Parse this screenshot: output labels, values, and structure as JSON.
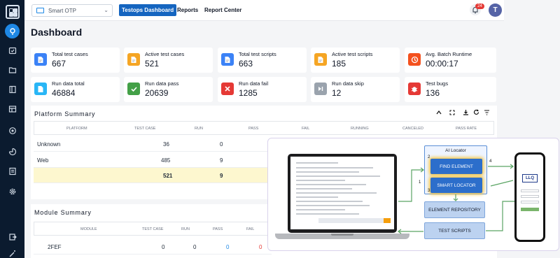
{
  "topbar": {
    "project": "Smart OTP",
    "nav": [
      "Testops Dashboard",
      "Reports",
      "Report Center"
    ],
    "notification_count": "24",
    "avatar_initial": "T"
  },
  "page_title": "Dashboard",
  "stats": [
    {
      "label": "Total test cases",
      "value": "667",
      "color": "#3b82f6",
      "icon": "document-icon"
    },
    {
      "label": "Active test cases",
      "value": "521",
      "color": "#f5a524",
      "icon": "document-icon"
    },
    {
      "label": "Total test scripts",
      "value": "663",
      "color": "#3b82f6",
      "icon": "document-icon"
    },
    {
      "label": "Active test scripts",
      "value": "185",
      "color": "#f5a524",
      "icon": "document-icon"
    },
    {
      "label": "Avg. Batch Runtime",
      "value": "00:00:17",
      "color": "#f4511e",
      "icon": "clock-icon"
    },
    {
      "label": "Run data total",
      "value": "46884",
      "color": "#29b6f6",
      "icon": "folder-icon"
    },
    {
      "label": "Run data pass",
      "value": "20639",
      "color": "#43a047",
      "icon": "check-icon"
    },
    {
      "label": "Run data fail",
      "value": "1285",
      "color": "#e53935",
      "icon": "close-icon"
    },
    {
      "label": "Run data skip",
      "value": "12",
      "color": "#9aa3ad",
      "icon": "skip-icon"
    },
    {
      "label": "Test bugs",
      "value": "136",
      "color": "#e53935",
      "icon": "bug-icon"
    }
  ],
  "platform_summary": {
    "title": "Platform Summary",
    "columns": [
      "Platform",
      "Test case",
      "Run",
      "Pass",
      "Fail",
      "Running",
      "Canceled",
      "Pass rate"
    ],
    "rows": [
      {
        "platform": "Unknown",
        "test_case": "36",
        "run": "0"
      },
      {
        "platform": "Web",
        "test_case": "485",
        "run": "9"
      }
    ],
    "total": {
      "test_case": "521",
      "run": "9"
    }
  },
  "module_summary": {
    "title": "Module Summary",
    "columns": [
      "Module",
      "Test case",
      "Run",
      "Pass",
      "Fail"
    ],
    "rows": [
      {
        "module": "2FEF",
        "test_case": "0",
        "run": "0",
        "pass": "0",
        "fail": "0"
      }
    ]
  },
  "diagram": {
    "ai_locator_title": "AI Locator",
    "find_element": "FIND ELEMENT",
    "smart_locator": "SMART LOCATOR",
    "element_repository": "ELEMENT REPOSITORY",
    "test_scripts": "TEST SCRIPTS",
    "phone_logo": "LLQ",
    "step_1": "1",
    "step_2": "2",
    "step_3": "3",
    "step_4": "4"
  }
}
